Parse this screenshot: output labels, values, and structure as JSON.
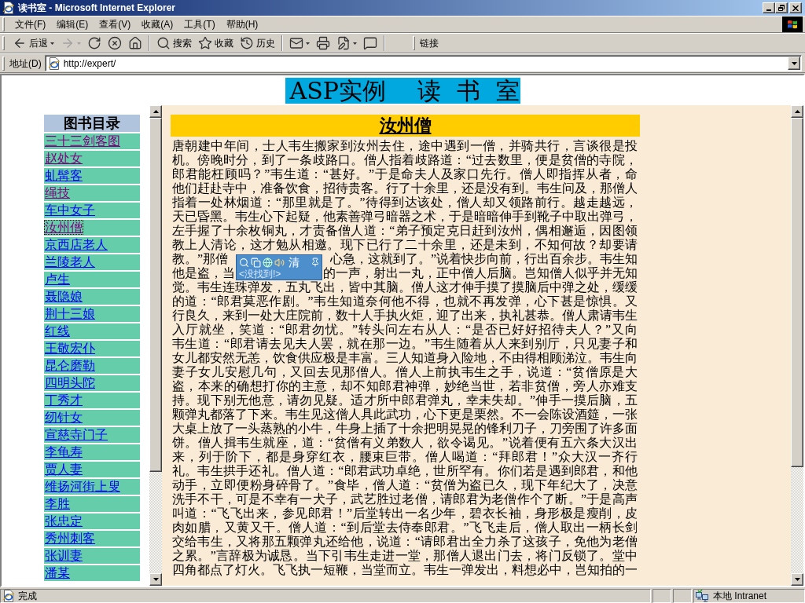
{
  "window": {
    "title": "读书室 - Microsoft Internet Explorer"
  },
  "menu_bar": [
    "文件(F)",
    "编辑(E)",
    "查看(V)",
    "收藏(A)",
    "工具(T)",
    "帮助(H)"
  ],
  "toolbar": [
    {
      "kind": "back",
      "label": "后退",
      "dropdown": true,
      "disabled": false
    },
    {
      "kind": "forward",
      "dropdown": true,
      "disabled": true
    },
    {
      "kind": "refresh",
      "disabled": false
    },
    {
      "kind": "stop",
      "disabled": false
    },
    {
      "kind": "home",
      "disabled": false
    },
    {
      "kind": "separator"
    },
    {
      "kind": "search",
      "label": "搜索",
      "disabled": false
    },
    {
      "kind": "favorites",
      "label": "收藏",
      "disabled": false
    },
    {
      "kind": "history",
      "label": "历史",
      "disabled": false
    },
    {
      "kind": "separator"
    },
    {
      "kind": "mail",
      "dropdown": true,
      "disabled": false
    },
    {
      "kind": "print",
      "disabled": false
    },
    {
      "kind": "edit",
      "dropdown": true,
      "disabled": false
    },
    {
      "kind": "discuss",
      "disabled": false
    },
    {
      "kind": "separator"
    }
  ],
  "links_bar": {
    "label": "链接"
  },
  "address_bar": {
    "label": "地址(D)",
    "value": "http://expert/"
  },
  "banner": [
    "ASP实例",
    "读",
    "书",
    "室"
  ],
  "sidebar": {
    "heading": "图书目录",
    "items": [
      {
        "label": "三十三剑客图",
        "visited": true,
        "selected": false
      },
      {
        "label": "赵处女",
        "visited": true,
        "selected": false
      },
      {
        "label": "虬髯客",
        "visited": false,
        "selected": false
      },
      {
        "label": "绳技",
        "visited": true,
        "selected": false
      },
      {
        "label": "车中女子",
        "visited": false,
        "selected": false
      },
      {
        "label": "汝州僧",
        "visited": true,
        "selected": true
      },
      {
        "label": "京西店老人",
        "visited": false,
        "selected": false
      },
      {
        "label": "兰陵老人",
        "visited": false,
        "selected": false
      },
      {
        "label": "卢生",
        "visited": false,
        "selected": false
      },
      {
        "label": "聂隐娘",
        "visited": false,
        "selected": false
      },
      {
        "label": "荆十三娘",
        "visited": false,
        "selected": false
      },
      {
        "label": "红线",
        "visited": false,
        "selected": false
      },
      {
        "label": "王敬宏仆",
        "visited": false,
        "selected": false
      },
      {
        "label": "昆仑磨勒",
        "visited": false,
        "selected": false
      },
      {
        "label": "四明头陀",
        "visited": false,
        "selected": false
      },
      {
        "label": "丁秀才",
        "visited": false,
        "selected": false
      },
      {
        "label": "纫针女",
        "visited": false,
        "selected": false
      },
      {
        "label": "宣慈寺门子",
        "visited": false,
        "selected": false
      },
      {
        "label": "李龟寿",
        "visited": false,
        "selected": false
      },
      {
        "label": "贾人妻",
        "visited": false,
        "selected": false
      },
      {
        "label": "维扬河街上叟",
        "visited": false,
        "selected": false
      },
      {
        "label": "李胜",
        "visited": false,
        "selected": false
      },
      {
        "label": "张忠定",
        "visited": false,
        "selected": false
      },
      {
        "label": "秀州刺客",
        "visited": false,
        "selected": false
      },
      {
        "label": "张训妻",
        "visited": false,
        "selected": false
      },
      {
        "label": "潘某",
        "visited": false,
        "selected": false
      }
    ]
  },
  "story": {
    "title": "汝州僧",
    "text_above_popup": [
      "唐朝建中年间，士人韦生搬家到汝州去住，途中遇到一僧，并骑共行，言谈很是投",
      "机。傍晚时分，到了一条歧路口。僧人指着歧路道：“过去数里，便是贫僧的寺院，",
      "郎君能枉顾吗？”韦生道：“甚好。”于是命夫人及家口先行。僧人即指挥从者，命",
      "他们赶赴寺中，准备饮食，招待贵客。行了十余里，还是没有到。韦生问及，那僧人",
      "指着一处林烟道：“那里就是了。”待得到达该处，僧人却又领路前行。越走越远，",
      "天已昏黑。韦生心下起疑，他素善弹弓暗器之术，于是暗暗伸手到靴子中取出弹弓，",
      "左手握了十余枚铜丸，才责备僧人道：“弟子预定克日赶到汝州，偶相邂逅，因图领",
      "教上人清论，这才勉从相邀。现下已行了二十余里，还是未到，不知何故？却要请"
    ],
    "lines_beside_popup": [
      {
        "left": "教。”那僧",
        "right": "心急，这就到了。”说着快步向前，行出百余步。韦生知"
      },
      {
        "left": "他是盗，当",
        "right": "的一声，射出一丸，正中僧人后脑。岂知僧人似乎并无知"
      }
    ],
    "text_below_popup": [
      "觉。韦生连珠弹发，五丸飞出，皆中其脑。僧人这才伸手摸了摸脑后中弹之处，缓缓",
      "的道：“郎君莫恶作剧。”韦生知道奈何他不得，也就不再发弹，心下甚是惊惧。又",
      "行良久，来到一处大庄院前，数十人手执火炬，迎了出来，执礼甚恭。僧人肃请韦生",
      "入厅就坐，笑道：“郎君勿忧。”转头问左右从人：“是否已好好招待夫人？”又向",
      "韦生道：“郎君请去见夫人罢，就在那一边。”韦生随着从人来到别厅，只见妻子和",
      "女儿都安然无恙，饮食供应极是丰富。三人知道身入险地，不由得相顾涕泣。韦生向",
      "妻子女儿安慰几句，又回去见那僧人。僧人上前执韦生之手，说道：“贫僧原是大",
      "盗，本来的确想打你的主意，却不知郎君神弹，妙绝当世，若非贫僧，旁人亦难支",
      "持。现下别无他意，请勿见疑。适才所中郎君弹丸，幸未失却。”伸手一摸后脑，五",
      "颗弹丸都落了下来。韦生见这僧人具此武功，心下更是栗然。不一会陈设酒筵，一张",
      "大桌上放了一头蒸熟的小牛，牛身上插了十余把明晃晃的锋利刀子，刀旁围了许多面",
      "饼。僧人揖韦生就座，道：“贫僧有义弟数人，欲令谒见。”说着便有五六条大汉出",
      "来，列于阶下，都是身穿红衣，腰束巨带。僧人喝道：“拜郎君！”众大汉一齐行",
      "礼。韦生拱手还礼。僧人道：“郎君武功卓绝，世所罕有。你们若是遇到郎君，和他",
      "动手，立即便粉身碎骨了。”食毕，僧人道：“贫僧为盗已久，现下年纪大了，决意",
      "洗手不干，可是不幸有一犬子，武艺胜过老僧，请郎君为老僧作个了断。”于是高声",
      "叫道：“飞飞出来，参见郎君！”后堂转出一名少年，碧衣长袖，身形极是瘦削，皮",
      "肉如腊，又黄又干。僧人道：“到后堂去侍奉郎君。”飞飞走后，僧人取出一柄长剑",
      "交给韦生，又将那五颗弹丸还给他，说道：“请郎君出全力杀了这孩子，免他为老僧",
      "之累。”言辞极为诚恳。当下引韦生走进一堂，那僧人退出门去，将门反锁了。堂中",
      "四角都点了灯火。飞飞执一短鞭，当堂而立。韦生一弹发出，料想必中，岂知拍的一"
    ]
  },
  "popup": {
    "word": "清",
    "result": "<没找到!>"
  },
  "status_bar": {
    "text": "完成",
    "zone": "本地 Intranet"
  }
}
